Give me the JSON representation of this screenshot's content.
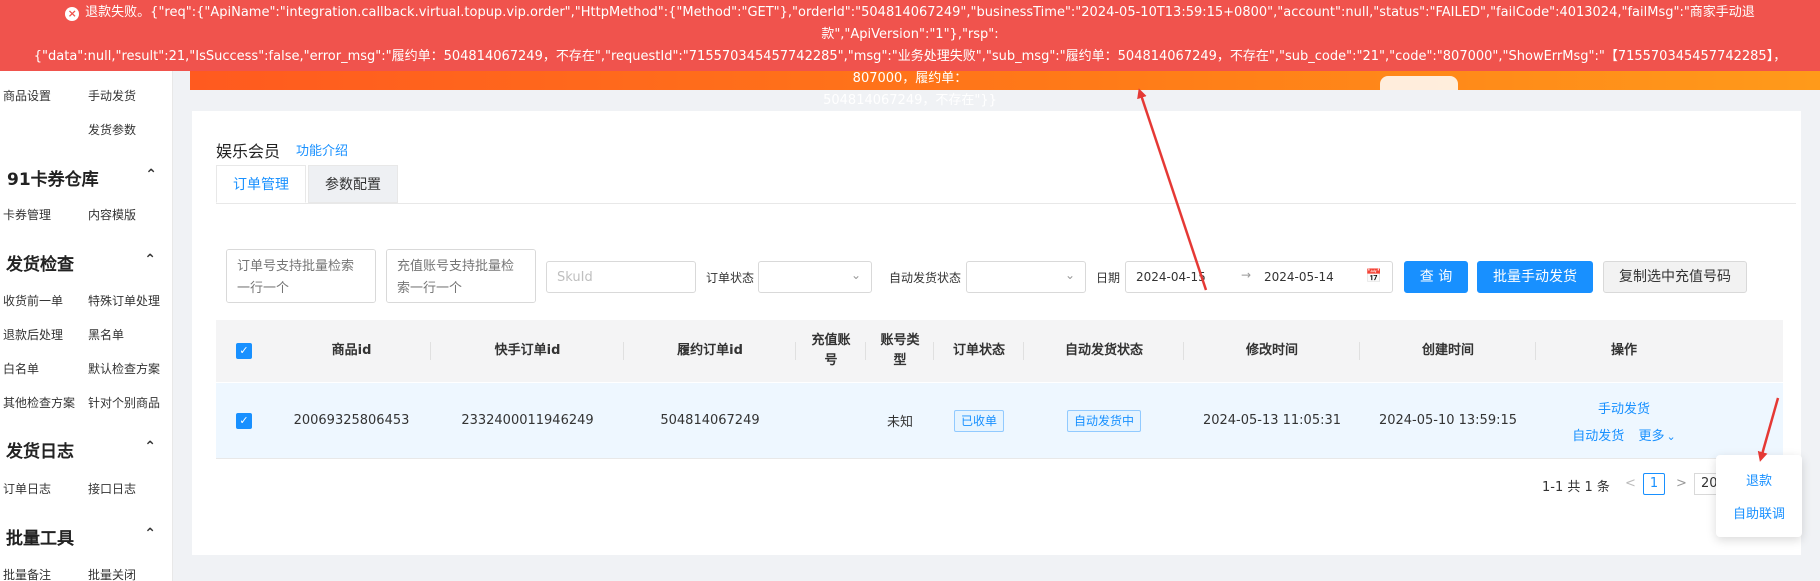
{
  "error": {
    "line1": "退款失败。{\"req\":{\"ApiName\":\"integration.callback.virtual.topup.vip.order\",\"HttpMethod\":{\"Method\":\"GET\"},\"orderId\":\"504814067249\",\"businessTime\":\"2024-05-10T13:59:15+0800\",\"account\":null,\"status\":\"FAILED\",\"failCode\":4013024,\"failMsg\":\"商家手动退款\",\"ApiVersion\":\"1\"},\"rsp\":",
    "line2": "{\"data\":null,\"result\":21,\"IsSuccess\":false,\"error_msg\":\"履约单：504814067249，不存在\",\"requestId\":\"715570345457742285\",\"msg\":\"业务处理失败\",\"sub_msg\":\"履约单：504814067249，不存在\",\"sub_code\":\"21\",\"code\":\"807000\",\"ShowErrMsg\":\"【715570345457742285】，807000，履约单：",
    "line3": "504814067249，不存在\"}}"
  },
  "sidebar": {
    "row0": [
      "商品设置",
      "手动发货"
    ],
    "row1": [
      "发货参数"
    ],
    "groups": [
      {
        "title": "91卡券仓库",
        "caret": "^",
        "rows": [
          [
            "卡券管理",
            "内容模版"
          ]
        ]
      },
      {
        "title": "发货检查",
        "caret": "^",
        "rows": [
          [
            "收货前一单",
            "特殊订单处理"
          ],
          [
            "退款后处理",
            "黑名单"
          ],
          [
            "白名单",
            "默认检查方案"
          ],
          [
            "其他检查方案",
            "针对个别商品"
          ]
        ]
      },
      {
        "title": "发货日志",
        "caret": "^",
        "rows": [
          [
            "订单日志",
            "接口日志"
          ]
        ]
      },
      {
        "title": "批量工具",
        "caret": "^",
        "rows": [
          [
            "批量备注",
            "批量关闭"
          ]
        ]
      }
    ]
  },
  "page": {
    "title": "娱乐会员",
    "help_link": "功能介绍",
    "tabs": [
      "订单管理",
      "参数配置"
    ]
  },
  "filters": {
    "order_no_placeholder": "订单号支持批量检索一行一个",
    "account_placeholder": "充值账号支持批量检索一行一个",
    "skuid_placeholder": "SkuId",
    "order_status_label": "订单状态",
    "auto_ship_status_label": "自动发货状态",
    "date_label": "日期",
    "date_start": "2024-04-15",
    "date_end": "2024-05-14",
    "query_button": "查 询",
    "batch_ship_button": "批量手动发货",
    "copy_button": "复制选中充值号码"
  },
  "table": {
    "headers": [
      "商品id",
      "快手订单id",
      "履约订单id",
      "充值账号",
      "账号类型",
      "订单状态",
      "自动发货状态",
      "修改时间",
      "创建时间",
      "操作"
    ],
    "rows": [
      {
        "product_id": "20069325806453",
        "kuaishou_order_id": "2332400011946249",
        "fulfill_order_id": "504814067249",
        "account": "",
        "account_type": "未知",
        "order_status": "已收单",
        "auto_ship_status": "自动发货中",
        "modified": "2024-05-13 11:05:31",
        "created": "2024-05-10 13:59:15",
        "actions": {
          "manual_ship": "手动发货",
          "auto_ship": "自动发货",
          "more": "更多"
        }
      }
    ]
  },
  "pagination": {
    "total_text": "1-1 共 1 条",
    "current_page": "1",
    "page_size": "20"
  },
  "dropdown": {
    "items": [
      "退款",
      "自助联调"
    ]
  },
  "colors": {
    "error_bg": "#f0534d",
    "primary": "#1890ff",
    "annotation_arrow": "#e53935"
  }
}
